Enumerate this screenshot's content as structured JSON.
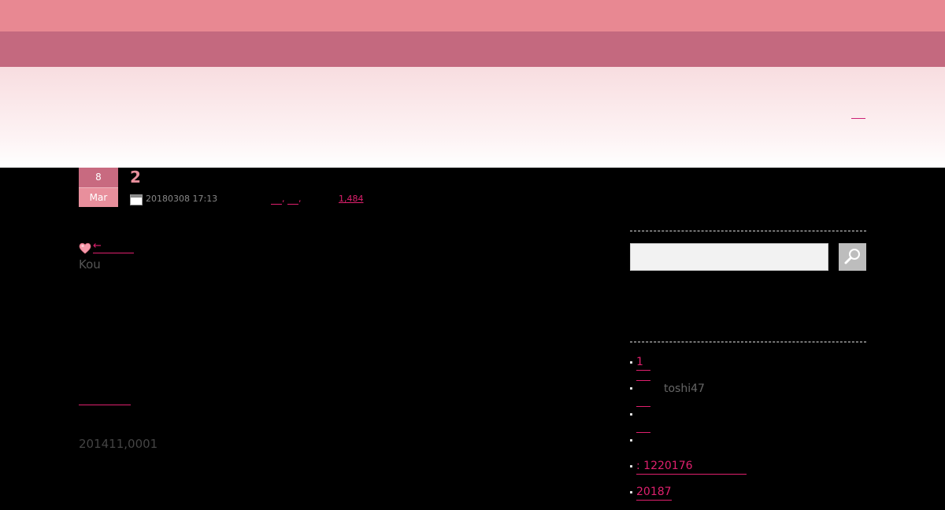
{
  "header": {
    "link_label": ""
  },
  "post": {
    "day": "8",
    "month": "Mar",
    "title": "2",
    "datetime": "20180308 17:13",
    "tags": [
      ",",
      ","
    ],
    "views": "1,484",
    "arrow_link": "←",
    "author": "Kou",
    "mid_link": "",
    "bottom_text": "201411,0001"
  },
  "sidebar": {
    "search_placeholder": "",
    "items": [
      {
        "label": "1",
        "extra": ""
      },
      {
        "label": "",
        "extra": "toshi47"
      },
      {
        "label": "",
        "extra": ""
      },
      {
        "label": "",
        "extra": ""
      },
      {
        "label": ": 1220176",
        "extra": ""
      },
      {
        "label": "20187",
        "extra": ""
      }
    ]
  },
  "colors": {
    "accent": "#e0206e",
    "topbar": "#e88892",
    "navbar": "#c4697f"
  }
}
